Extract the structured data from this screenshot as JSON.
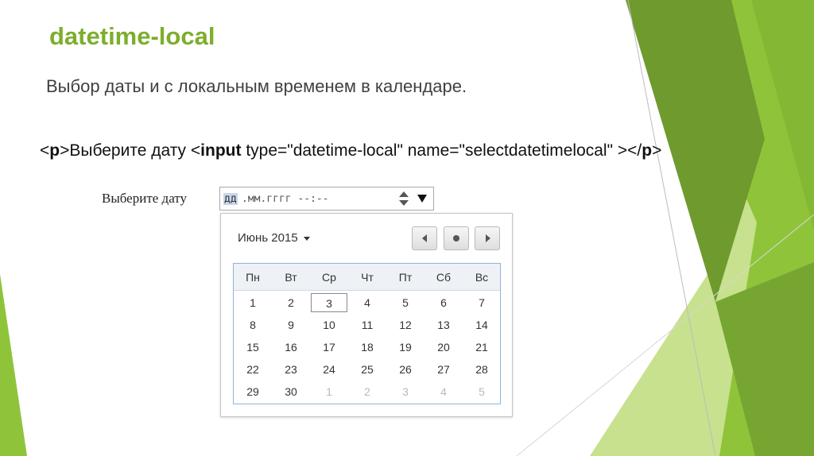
{
  "slide": {
    "title": "datetime-local",
    "subtitle": "Выбор даты и с локальным временем в календаре.",
    "code": {
      "lt1": "<",
      "p_open": "p",
      "gt_text": ">Выберите дату <",
      "input_tag": "input",
      "attrs": " type=\"datetime-local\" name=\"selectdatetimelocal\" ></",
      "p_close": "p",
      "gt_end": ">"
    }
  },
  "demo": {
    "label": "Выберите дату",
    "input": {
      "day_segment": "дд",
      "rest": ".мм.гггг --:--"
    },
    "calendar": {
      "month_label": "Июнь 2015",
      "weekdays": [
        "Пн",
        "Вт",
        "Ср",
        "Чт",
        "Пт",
        "Сб",
        "Вс"
      ],
      "weeks": [
        [
          "1",
          "2",
          "3",
          "4",
          "5",
          "6",
          "7"
        ],
        [
          "8",
          "9",
          "10",
          "11",
          "12",
          "13",
          "14"
        ],
        [
          "15",
          "16",
          "17",
          "18",
          "19",
          "20",
          "21"
        ],
        [
          "22",
          "23",
          "24",
          "25",
          "26",
          "27",
          "28"
        ],
        [
          "29",
          "30",
          "1",
          "2",
          "3",
          "4",
          "5"
        ]
      ],
      "highlighted_day": "3",
      "other_month_from_index": 30
    }
  },
  "colors": {
    "title": "#7cae2c",
    "green_dark": "#6f9a2e",
    "green_mid": "#8fc43a",
    "green_light": "#c7e18e"
  },
  "icons": {
    "spinner": "up-down-spinner-icon",
    "dropdown": "dropdown-arrow-icon",
    "prev": "chevron-left-icon",
    "today": "dot-icon",
    "next": "chevron-right-icon"
  }
}
